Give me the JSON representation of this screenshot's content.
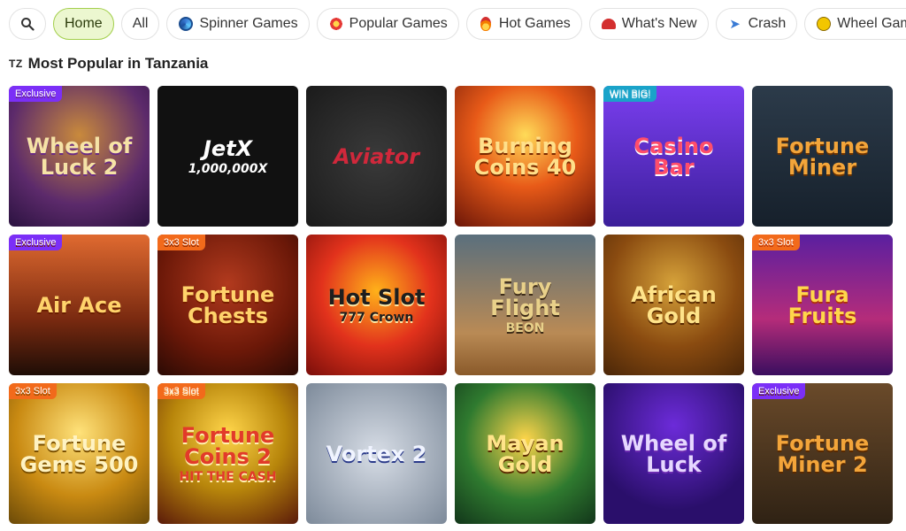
{
  "filters": {
    "search_icon": "search-icon",
    "chips": [
      {
        "label": "Home",
        "active": true,
        "icon": ""
      },
      {
        "label": "All",
        "active": false,
        "icon": ""
      },
      {
        "label": "Spinner Games",
        "active": false,
        "icon": "spinner-icon"
      },
      {
        "label": "Popular Games",
        "active": false,
        "icon": "popular-icon"
      },
      {
        "label": "Hot Games",
        "active": false,
        "icon": "fire-icon"
      },
      {
        "label": "What's New",
        "active": false,
        "icon": "siren-icon"
      },
      {
        "label": "Crash",
        "active": false,
        "icon": "rocket-icon"
      },
      {
        "label": "Wheel Games",
        "active": false,
        "icon": "wheel-icon"
      }
    ]
  },
  "section": {
    "flag_code": "TZ",
    "title": "Most Popular in Tanzania"
  },
  "games": [
    {
      "name": "Wheel of Luck 2",
      "badge": "Exclusive",
      "badge_type": "exclusive"
    },
    {
      "name": "JetX",
      "sub": "1,000,000X"
    },
    {
      "name": "Aviator"
    },
    {
      "name": "Burning Coins 40"
    },
    {
      "name": "Casino Bar",
      "badge": "WIN BIG!",
      "badge_type": "win"
    },
    {
      "name": "Fortune Miner"
    },
    {
      "name": "Air Ace",
      "badge": "Exclusive",
      "badge_type": "exclusive"
    },
    {
      "name": "Fortune Chests",
      "badge": "3x3 Slot",
      "badge_type": "slot"
    },
    {
      "name": "Hot Slot",
      "sub": "777 Crown"
    },
    {
      "name": "Fury Flight",
      "sub": "BEON"
    },
    {
      "name": "African Gold"
    },
    {
      "name": "Fura Fruits",
      "badge": "3x3 Slot",
      "badge_type": "slot"
    },
    {
      "name": "Fortune Gems 500",
      "badge": "3x3 Slot",
      "badge_type": "slot"
    },
    {
      "name": "Fortune Coins 2",
      "badge": "3x3 Slot",
      "badge_type": "slot",
      "sub": "HIT THE CASH"
    },
    {
      "name": "Vortex 2"
    },
    {
      "name": "Mayan Gold"
    },
    {
      "name": "Wheel of Luck"
    },
    {
      "name": "Fortune Miner 2",
      "badge": "Exclusive",
      "badge_type": "exclusive"
    }
  ]
}
